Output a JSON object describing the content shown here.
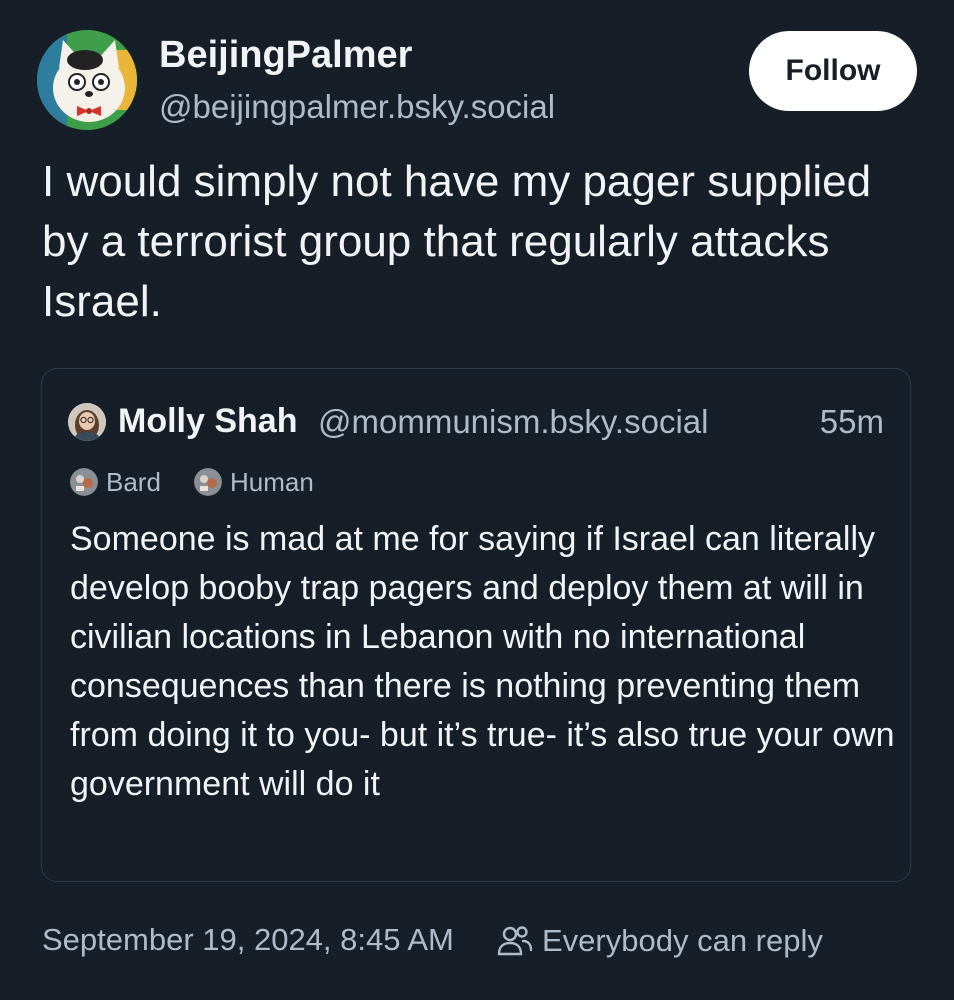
{
  "post": {
    "author": {
      "display_name": "BeijingPalmer",
      "handle": "@beijingpalmer.bsky.social",
      "avatar_icon": "cartoon-cat-avatar-icon"
    },
    "follow_label": "Follow",
    "text": "I would simply not have my pager supplied by a terrorist group that regularly attacks Israel.",
    "timestamp": "September 19, 2024, 8:45 AM",
    "reply_setting": "Everybody can reply",
    "reply_icon": "people-icon"
  },
  "quoted_post": {
    "author": {
      "display_name": "Molly Shah",
      "handle": "@mommunism.bsky.social",
      "avatar_icon": "user-photo-avatar-icon"
    },
    "time": "55m",
    "labels": [
      {
        "label": "Bard",
        "icon": "labeler-icon"
      },
      {
        "label": "Human",
        "icon": "labeler-icon"
      }
    ],
    "text": "Someone is mad at me for saying if Israel can literally develop booby trap pagers and deploy them at will in civilian locations in Lebanon with no international consequences than there is nothing preventing them from doing it to you- but it’s true- it’s also true your own government will do it"
  },
  "colors": {
    "background": "#161e27",
    "text_primary": "#f1f3f5",
    "text_secondary": "#aebbc9",
    "border": "#2e3a47",
    "button_bg": "#ffffff"
  }
}
